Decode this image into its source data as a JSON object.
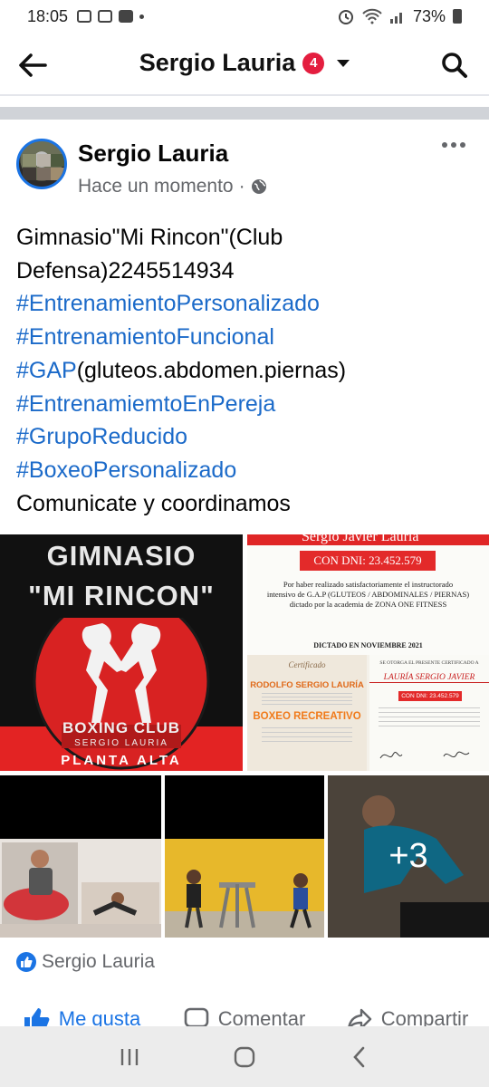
{
  "status": {
    "time": "18:05",
    "battery": "73%"
  },
  "nav": {
    "title": "Sergio Lauria",
    "badge": "4"
  },
  "post": {
    "author": "Sergio Lauria",
    "timestamp": "Hace un momento",
    "separator": "·",
    "lines": [
      {
        "text": "Gimnasio\"Mi Rincon\"(Club"
      },
      {
        "text": "Defensa)2245514934"
      },
      {
        "tag": "#EntrenamientoPersonalizado"
      },
      {
        "tag": "#EntrenamientoFuncional"
      },
      {
        "tag": "#GAP",
        "text": "(gluteos.abdomen.piernas)"
      },
      {
        "tag": "#EntrenamiemtoEnPereja"
      },
      {
        "tag": "#GrupoReducido"
      },
      {
        "tag": "#BoxeoPersonalizado"
      },
      {
        "text": "Comunicate y coordinamos"
      }
    ]
  },
  "photos": {
    "gym": {
      "line1": "GIMNASIO",
      "line2": "\"MI RINCON\"",
      "club": "BOXING CLUB",
      "owner": "SERGIO LAURIA",
      "floor": "PLANTA ALTA"
    },
    "cert": {
      "top_name": "Sergio Javier Lauria",
      "dni": "CON DNI: 23.452.579",
      "body1": "Por haber realizado satisfactoriamente el instructorado",
      "body2": "intensivo de G.A.P (GLUTEOS / ABDOMINALES / PIERNAS)",
      "body3": "dictado por la academia de ZONA ONE FITNESS",
      "date": "DICTADO EN NOVIEMBRE 2021"
    },
    "cert2": {
      "heading": "Certificado",
      "name": "RODOLFO SERGIO LAURÍA",
      "course": "BOXEO RECREATIVO",
      "right_header": "SE OTORGA EL PRESENTE CERTIFICADO A",
      "right_name": "LAURÍA SERGIO JAVIER",
      "right_dni": "CON DNI: 23.452.579"
    },
    "more_count": "+3"
  },
  "reactions": {
    "names": "Sergio Lauria"
  },
  "actions": {
    "like": "Me gusta",
    "comment": "Comentar",
    "share": "Compartir"
  },
  "colors": {
    "accent": "#1b74e4",
    "hashtag": "#1b6ac9",
    "badge": "#e41e3f"
  }
}
